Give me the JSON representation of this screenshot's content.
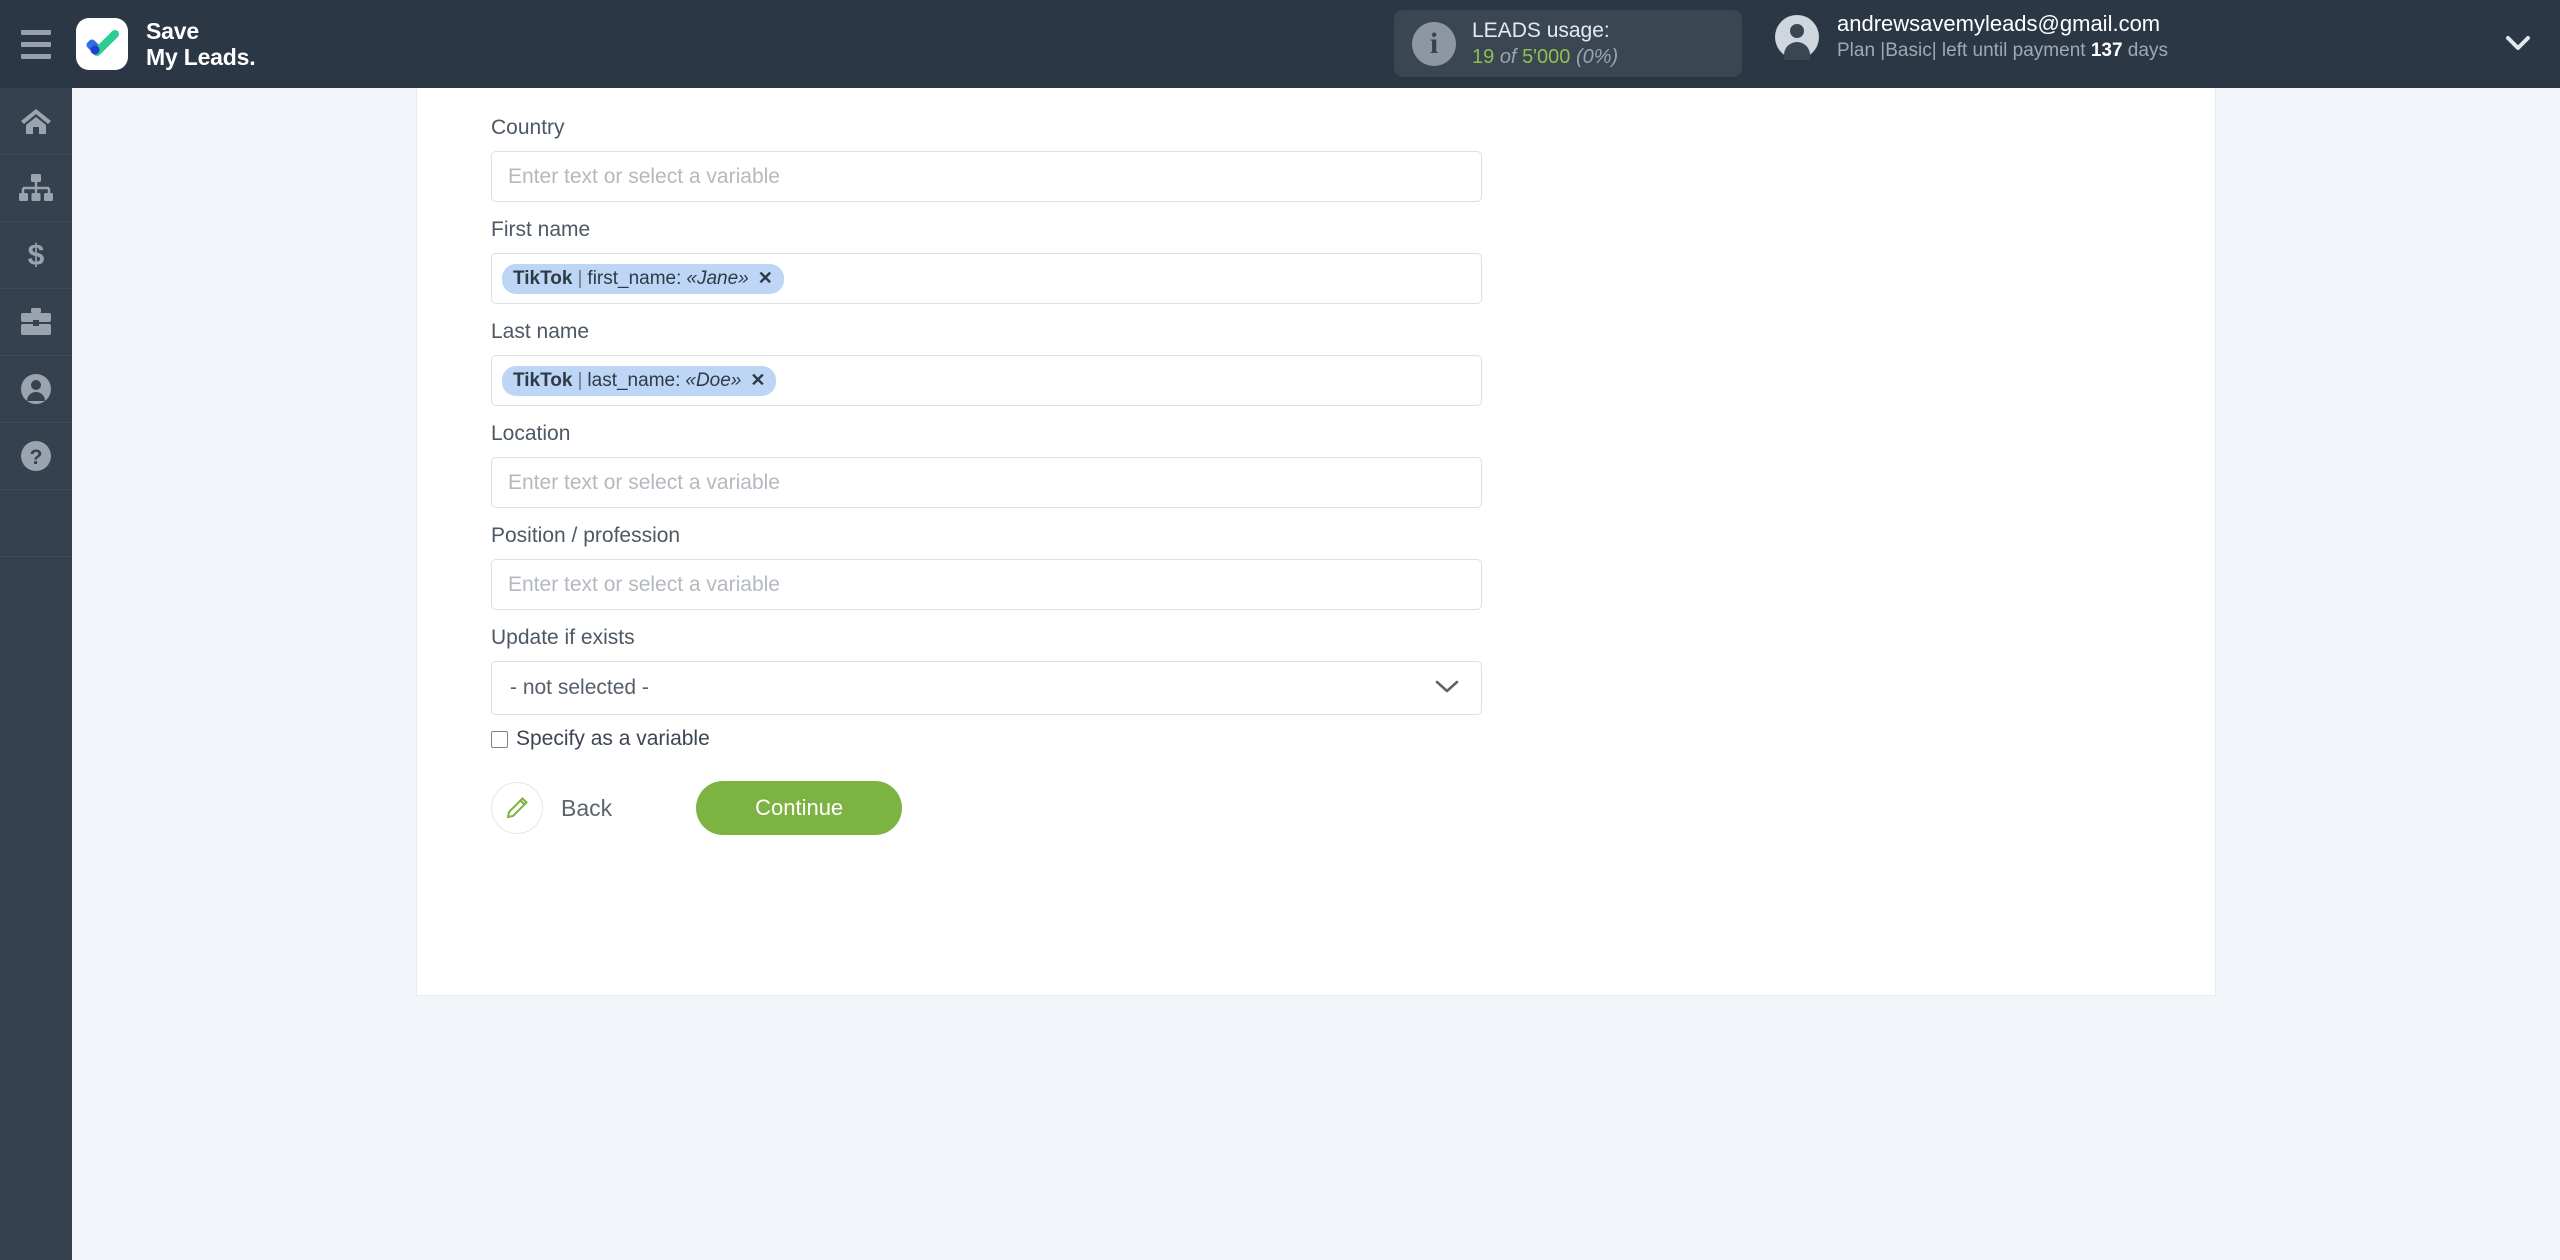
{
  "header": {
    "menu_icon": "hamburger-icon",
    "brand": {
      "line1": "Save",
      "line2": "My Leads."
    },
    "usage": {
      "icon": "info-icon",
      "title": "LEADS usage:",
      "used": "19",
      "of": "of",
      "total": "5'000",
      "percent": "(0%)"
    },
    "account": {
      "avatar_icon": "user-avatar-icon",
      "email": "andrewsavemyleads@gmail.com",
      "plan": "Plan |Basic| left until payment ",
      "days_value": "137",
      "days_suffix": " days",
      "caret_icon": "chevron-down-icon"
    }
  },
  "sidebar": {
    "items": [
      {
        "icon": "home-icon",
        "name": "sidebar-item-home"
      },
      {
        "icon": "connections-icon",
        "name": "sidebar-item-connections"
      },
      {
        "icon": "dollar-icon",
        "name": "sidebar-item-billing"
      },
      {
        "icon": "briefcase-icon",
        "name": "sidebar-item-business"
      },
      {
        "icon": "user-icon",
        "name": "sidebar-item-account"
      },
      {
        "icon": "help-icon",
        "name": "sidebar-item-help"
      }
    ]
  },
  "form": {
    "placeholder": "Enter text or select a variable",
    "fields": [
      {
        "label": "Country",
        "type": "text",
        "value": ""
      },
      {
        "label": "First name",
        "type": "pill",
        "pill": {
          "source": "TikTok",
          "sep": "|",
          "key": "first_name:",
          "value": "«Jane»",
          "remove": "✕"
        }
      },
      {
        "label": "Last name",
        "type": "pill",
        "pill": {
          "source": "TikTok",
          "sep": "|",
          "key": "last_name:",
          "value": "«Doe»",
          "remove": "✕"
        }
      },
      {
        "label": "Location",
        "type": "text",
        "value": ""
      },
      {
        "label": "Position / profession",
        "type": "text",
        "value": ""
      }
    ],
    "update_if_exists": {
      "label": "Update if exists",
      "selected": "- not selected -",
      "caret_icon": "chevron-down-icon"
    },
    "specify_variable": {
      "label": "Specify as a variable",
      "checked": false
    },
    "actions": {
      "back_label": "Back",
      "back_icon": "pencil-icon",
      "continue_label": "Continue"
    }
  },
  "colors": {
    "header_bg": "#2b3744",
    "sidebar_bg": "#36414f",
    "page_bg": "#f2f5fa",
    "accent_green": "#7cb342",
    "pill_bg": "#bdd6f5",
    "usage_green": "#8cc152"
  }
}
